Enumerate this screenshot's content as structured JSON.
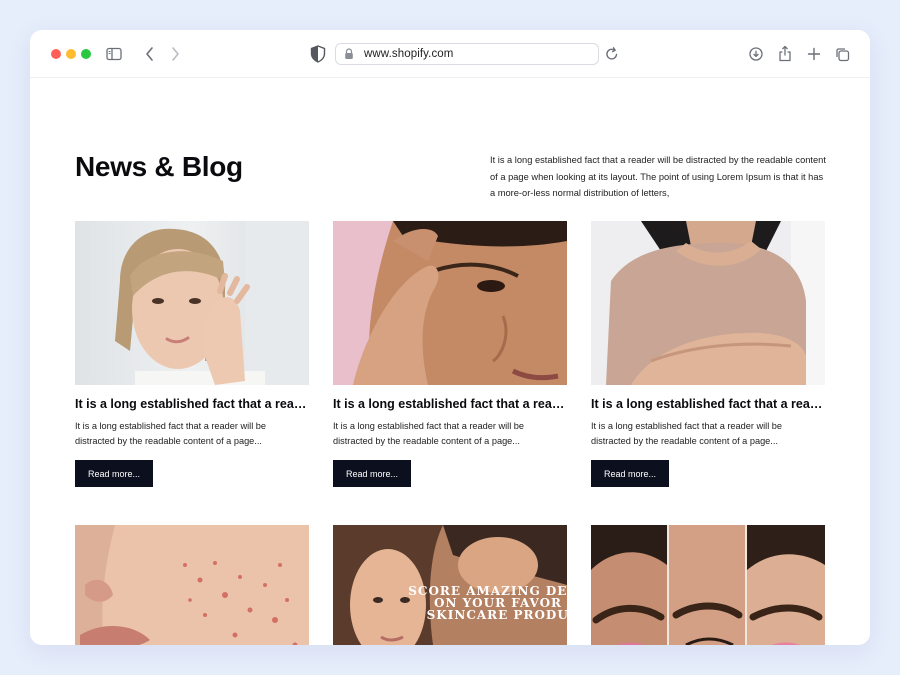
{
  "browser": {
    "url": "www.shopify.com"
  },
  "page": {
    "title": "News & Blog",
    "intro": "It is a long established fact that a reader will be distracted by the readable content of a page when looking at its layout. The point of using Lorem Ipsum is that it has a more-or-less normal distribution of letters,"
  },
  "posts": [
    {
      "title": "It is a long established fact that a reader will be distracted",
      "excerpt": "It is a long established fact that a reader will be distracted by the readable content of a page...",
      "cta": "Read more..."
    },
    {
      "title": "It is a long established fact that a reader will be distracted",
      "excerpt": "It is a long established fact that a reader will be distracted by the readable content of a page...",
      "cta": "Read more..."
    },
    {
      "title": "It is a long established fact that a reader will be distracted",
      "excerpt": "It is a long established fact that a reader will be distracted by the readable content of a page...",
      "cta": "Read more..."
    }
  ],
  "promo_overlay": [
    "SCORE AMAZING DEA",
    "ON YOUR FAVOR",
    "SKINCARE PRODUC"
  ],
  "colors": {
    "background": "#e6edfb",
    "button": "#0b0f1e",
    "traffic_red": "#fe5f57",
    "traffic_yellow": "#febc2e",
    "traffic_green": "#28c840"
  }
}
